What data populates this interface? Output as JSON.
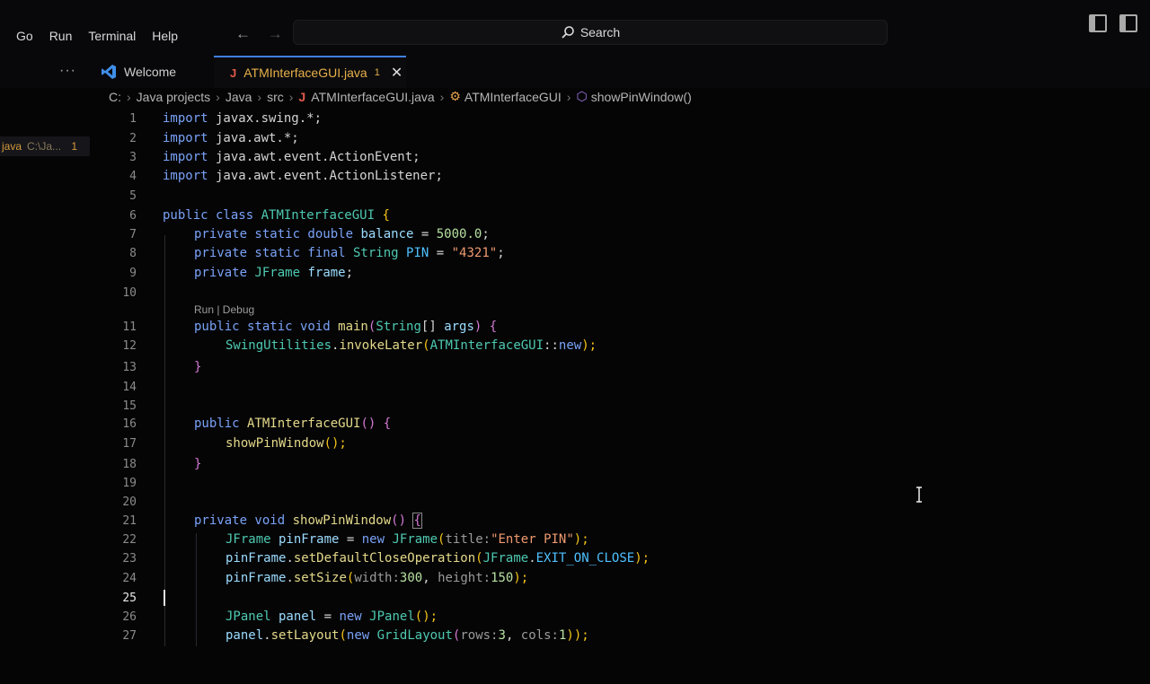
{
  "menu": [
    "Go",
    "Run",
    "Terminal",
    "Help"
  ],
  "nav": {
    "back": "←",
    "forward": "→"
  },
  "search": {
    "label": "Search"
  },
  "tabs": {
    "more": "···",
    "welcome": "Welcome",
    "active": "ATMInterfaceGUI.java",
    "active_badge": "1",
    "close": "✕"
  },
  "breadcrumb": [
    "C:",
    "Java projects",
    "Java",
    "src",
    "ATMInterfaceGUI.java",
    "ATMInterfaceGUI",
    "showPinWindow()"
  ],
  "explorer": {
    "name": "java",
    "path": "C:\\Ja...",
    "count": "1"
  },
  "codelens": "Run | Debug",
  "line_numbers": [
    "1",
    "2",
    "3",
    "4",
    "5",
    "6",
    "7",
    "8",
    "9",
    "10",
    "11",
    "12",
    "13",
    "14",
    "15",
    "16",
    "17",
    "18",
    "19",
    "20",
    "21",
    "22",
    "23",
    "24",
    "25",
    "26",
    "27"
  ],
  "code": {
    "l1": [
      "import",
      " javax.swing.*;"
    ],
    "l2": [
      "import",
      " java.awt.*;"
    ],
    "l3": [
      "import",
      " java.awt.event.ActionEvent;"
    ],
    "l4": [
      "import",
      " java.awt.event.ActionListener;"
    ],
    "l6": [
      "public class",
      " ATMInterfaceGUI",
      " {"
    ],
    "l7": [
      "private static double",
      " balance",
      " = ",
      "5000.0",
      ";"
    ],
    "l8": [
      "private static final",
      " String",
      " PIN",
      " = ",
      "\"4321\"",
      ";"
    ],
    "l9": [
      "private",
      " JFrame",
      " frame",
      ";"
    ],
    "l11": [
      "public static void",
      " main",
      "(",
      "String",
      "[] ",
      "args",
      ") {"
    ],
    "l12": [
      "SwingUtilities",
      ".",
      "invokeLater",
      "(",
      "ATMInterfaceGUI",
      "::",
      "new",
      ");"
    ],
    "l13": [
      "}"
    ],
    "l16": [
      "public",
      " ATMInterfaceGUI",
      "() {"
    ],
    "l17": [
      "showPinWindow",
      "();"
    ],
    "l18": [
      "}"
    ],
    "l21": [
      "private void",
      " showPinWindow",
      "() ",
      "{"
    ],
    "l22": [
      "JFrame",
      " pinFrame",
      " = ",
      "new",
      " JFrame",
      "(",
      "title:",
      "\"Enter PIN\"",
      ");"
    ],
    "l23": [
      "pinFrame",
      ".",
      "setDefaultCloseOperation",
      "(",
      "JFrame",
      ".",
      "EXIT_ON_CLOSE",
      ");"
    ],
    "l24": [
      "pinFrame",
      ".",
      "setSize",
      "(",
      "width:",
      "300",
      ", ",
      "height:",
      "150",
      ");"
    ],
    "l26": [
      "JPanel",
      " panel",
      " = ",
      "new",
      " JPanel",
      "();"
    ],
    "l27": [
      "panel",
      ".",
      "setLayout",
      "(",
      "new",
      " GridLayout",
      "(",
      "rows:",
      "3",
      ", ",
      "cols:",
      "1",
      "));"
    ]
  },
  "colors": {
    "accent": "#3f7fe0",
    "keyword": "#7aa2f7",
    "modified": "#e8b04a"
  }
}
